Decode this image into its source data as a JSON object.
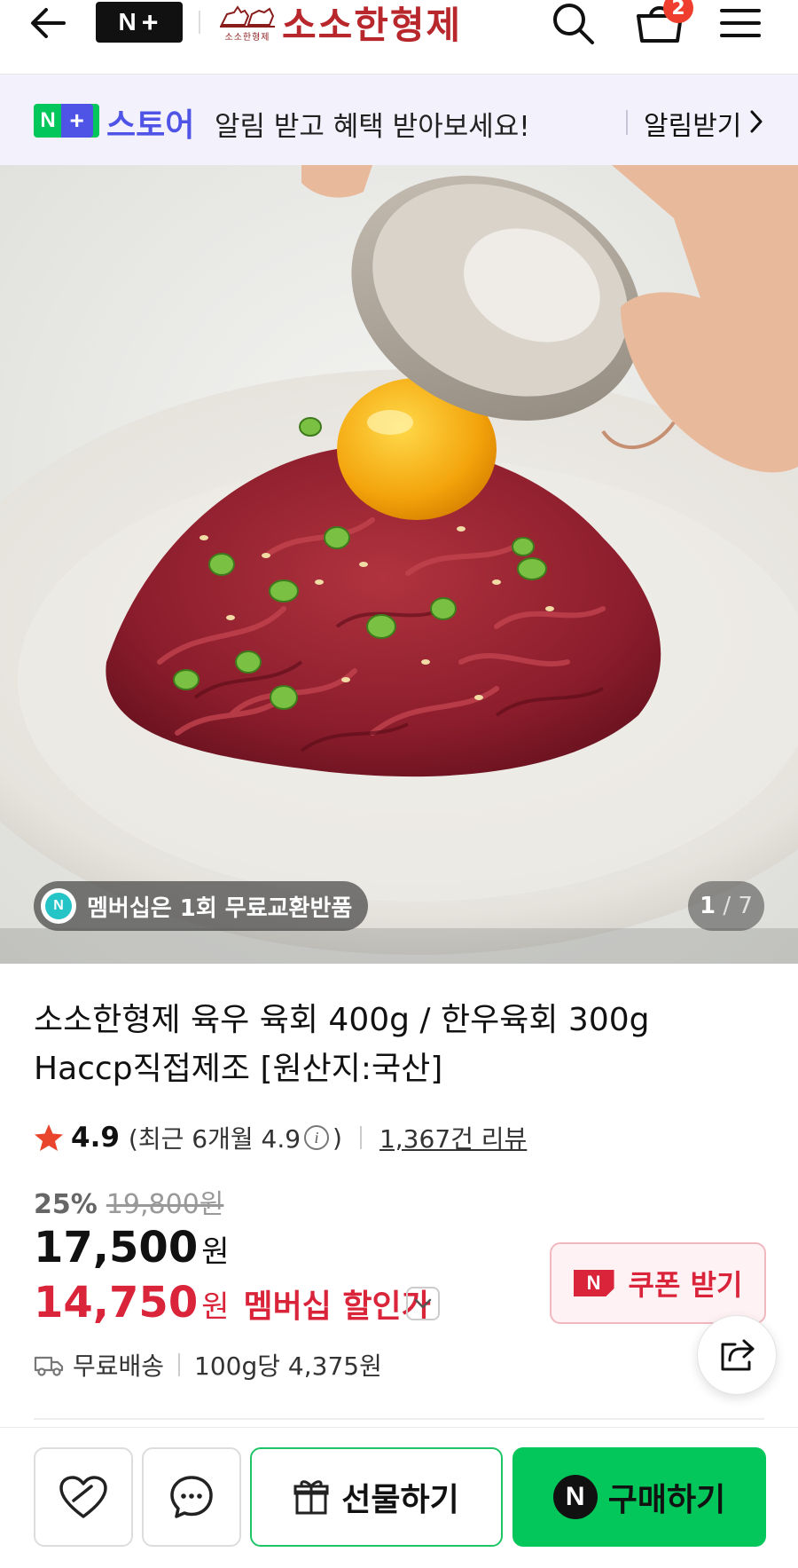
{
  "header": {
    "brand_badge": "N",
    "brand_badge_plus": "+",
    "store_name": "소소한형제",
    "store_emblem_sub": "소소한형제",
    "cart_count": "2",
    "icons": [
      "back-arrow-icon",
      "search-icon",
      "cart-icon",
      "menu-icon"
    ]
  },
  "notice": {
    "badge_n": "N",
    "badge_plus": "+",
    "store_label": "스토어",
    "message": "알림 받고 혜택 받아보세요!",
    "cta": "알림받기"
  },
  "gallery": {
    "membership_badge": "멤버십은 1회 무료교환반품",
    "membership_icon_letter": "N",
    "current_page": "1",
    "total_pages": "/ 7"
  },
  "product": {
    "title_line1": "소소한형제 육우 육회 400g / 한우육회 300g",
    "title_line2": "Haccp직접제조 [원산지:국산]",
    "rating": "4.9",
    "rating_recent_prefix": "(최근 6개월 4.9",
    "rating_recent_suffix": ")",
    "review_count": "1,367건 리뷰",
    "discount_rate": "25%",
    "original_price": "19,800원",
    "price": "17,500",
    "price_unit": "원",
    "member_price": "14,750",
    "member_price_unit": "원",
    "member_price_label": "멤버십 할인가",
    "coupon_logo": "N",
    "coupon_label": "쿠폰 받기",
    "shipping": "무료배송",
    "unit_price": "100g당 4,375원"
  },
  "actions": {
    "gift_label": "선물하기",
    "buy_logo": "N",
    "buy_label": "구매하기"
  },
  "colors": {
    "naver_green": "#03C75A",
    "store_purple": "#4F54E6",
    "member_red": "#D9243A",
    "brand_red": "#B8272C",
    "cart_badge": "#EF3E2E"
  }
}
